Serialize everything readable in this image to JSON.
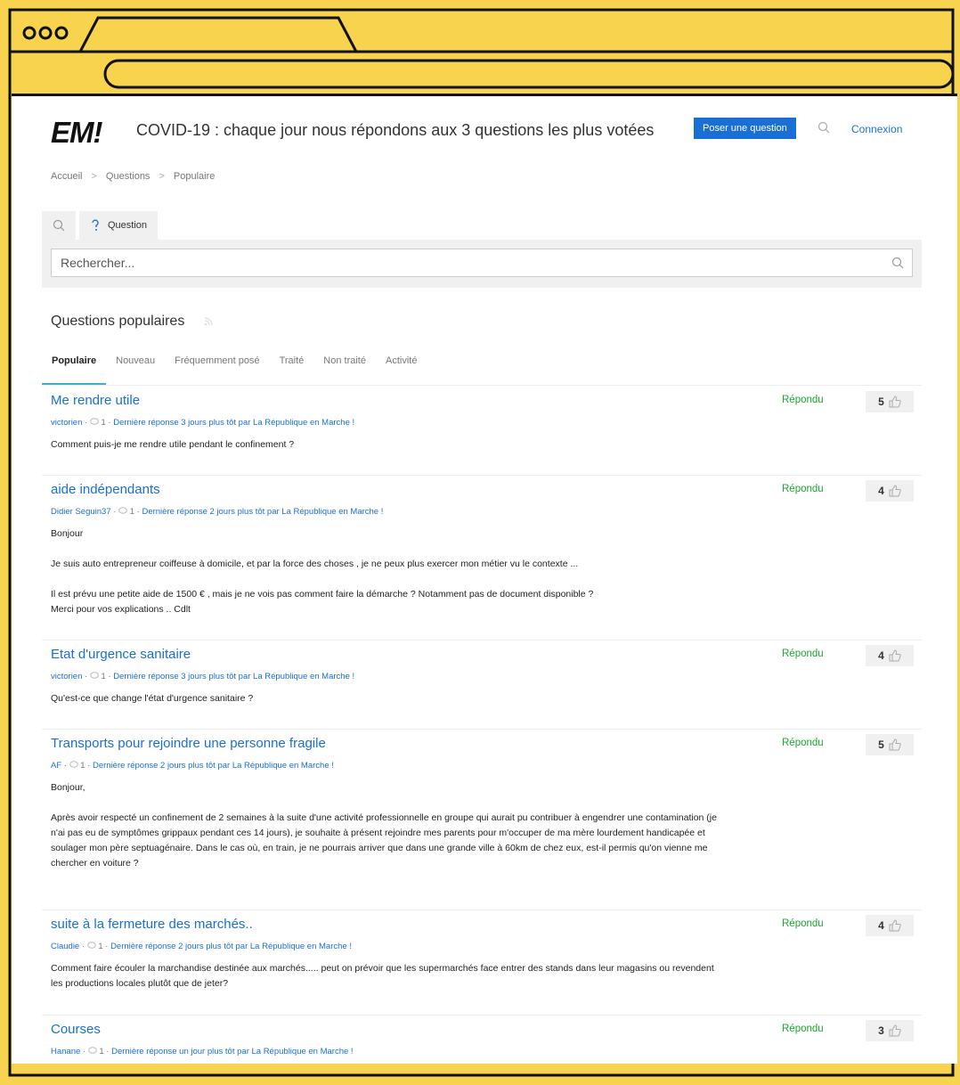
{
  "site": {
    "logo": "EM!",
    "title": "COVID-19 : chaque jour nous répondons aux 3 questions les plus votées",
    "ask_button": "Poser une question",
    "login": "Connexion"
  },
  "breadcrumb": [
    "Accueil",
    "Questions",
    "Populaire"
  ],
  "breadcrumb_sep": ">",
  "search": {
    "tab_label": "Question",
    "placeholder": "Rechercher..."
  },
  "section_title": "Questions populaires",
  "tabs": [
    "Populaire",
    "Nouveau",
    "Fréquemment posé",
    "Traité",
    "Non traité",
    "Activité"
  ],
  "questions": [
    {
      "title": "Me rendre utile",
      "author": "victorien",
      "answers": "1",
      "last_reply": "Dernière réponse 3 jours plus tôt par La République en Marche !",
      "body": [
        "Comment puis-je me rendre utile pendant le confinement ?"
      ],
      "status": "Répondu",
      "votes": "5"
    },
    {
      "title": "aide indépendants",
      "author": "Didier Seguin37",
      "answers": "1",
      "last_reply": "Dernière réponse 2 jours plus tôt par La République en Marche !",
      "body": [
        "Bonjour",
        "Je suis auto entrepreneur coiffeuse à domicile, et par la force des choses , je ne peux plus exercer mon métier vu le contexte ...",
        "Il est prévu une petite aide de 1500 € , mais je ne vois pas comment faire la démarche ? Notamment pas de document disponible ?\nMerci pour vos explications .. Cdlt"
      ],
      "status": "Répondu",
      "votes": "4"
    },
    {
      "title": "Etat d'urgence sanitaire",
      "author": "victorien",
      "answers": "1",
      "last_reply": "Dernière réponse 3 jours plus tôt par La République en Marche !",
      "body": [
        "Qu'est-ce que change l'état d'urgence sanitaire ?"
      ],
      "status": "Répondu",
      "votes": "4"
    },
    {
      "title": "Transports pour rejoindre une personne fragile",
      "author": "AF",
      "answers": "1",
      "last_reply": "Dernière réponse 2 jours plus tôt par La République en Marche !",
      "body": [
        "Bonjour,",
        "Après avoir respecté un confinement de 2 semaines à la suite d'une activité professionnelle en groupe qui aurait pu contribuer à engendrer une contamination (je n'ai pas eu de symptômes grippaux pendant ces 14 jours), je souhaite à présent rejoindre mes parents pour m'occuper de ma mère lourdement handicapée et soulager mon père septuagénaire. Dans le cas où, en train, je ne pourrais arriver que dans une grande ville à 60km de chez eux, est-il permis qu'on vienne me chercher en voiture ?"
      ],
      "status": "Répondu",
      "votes": "5"
    },
    {
      "title": "suite à la fermeture des marchés..",
      "author": "Claudie",
      "answers": "1",
      "last_reply": "Dernière réponse 2 jours plus tôt par La République en Marche !",
      "body": [
        "Comment faire écouler la marchandise destinée aux marchés..... peut on prévoir que les supermarchés face entrer des stands dans leur magasins ou revendent les productions locales plutôt que de jeter?"
      ],
      "status": "Répondu",
      "votes": "4"
    },
    {
      "title": "Courses",
      "author": "Hanane",
      "answers": "1",
      "last_reply": "Dernière réponse un jour plus tôt par La République en Marche !",
      "body": [],
      "status": "Répondu",
      "votes": "3"
    }
  ],
  "colors": {
    "accent": "#1a6fd6",
    "answered": "#1aa82f",
    "frame": "#f8d34d"
  }
}
